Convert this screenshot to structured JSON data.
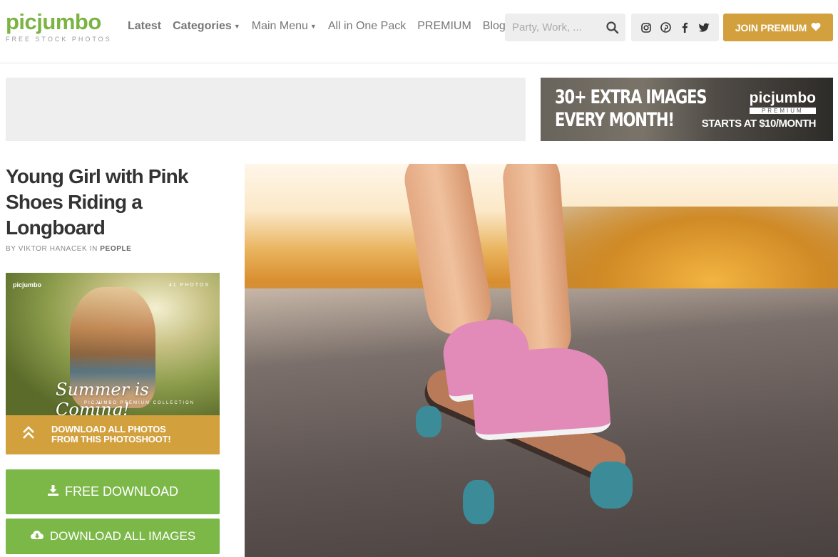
{
  "header": {
    "logo": {
      "name": "picjumbo",
      "tagline": "FREE STOCK PHOTOS"
    },
    "nav": [
      {
        "label": "Latest",
        "bold": true,
        "dropdown": false
      },
      {
        "label": "Categories",
        "bold": true,
        "dropdown": true
      },
      {
        "label": "Main Menu",
        "bold": false,
        "dropdown": true
      },
      {
        "label": "All in One Pack",
        "bold": false,
        "dropdown": false
      },
      {
        "label": "PREMIUM",
        "bold": false,
        "dropdown": false
      },
      {
        "label": "Blog",
        "bold": false,
        "dropdown": false
      }
    ],
    "search": {
      "placeholder": "Party, Work, ...",
      "value": ""
    },
    "social": [
      "instagram-icon",
      "pinterest-icon",
      "facebook-icon",
      "twitter-icon"
    ],
    "join_label": "JOIN PREMIUM"
  },
  "promo": {
    "line1": "30+ EXTRA IMAGES",
    "line2": "EVERY MONTH!",
    "brand": "picjumbo",
    "brand_tag": "PREMIUM",
    "price": "STARTS AT $10/MONTH"
  },
  "photo_page": {
    "title": "Young Girl with Pink Shoes Riding a Longboard",
    "byline_prefix": "BY VIKTOR HANACEK IN",
    "category": "PEOPLE"
  },
  "pack": {
    "logo": "picjumbo",
    "count": "41 PHOTOS",
    "title": "Summer is Coming!",
    "subtitle": "PICJUMBO PREMIUM COLLECTION",
    "button_line1": "DOWNLOAD ALL PHOTOS",
    "button_line2": "FROM THIS PHOTOSHOOT!"
  },
  "buttons": {
    "free_download": "FREE DOWNLOAD",
    "download_all": "DOWNLOAD ALL IMAGES"
  },
  "colors": {
    "brand_green": "#7bb442",
    "button_green": "#7cb848",
    "premium_gold": "#d3a03e"
  }
}
